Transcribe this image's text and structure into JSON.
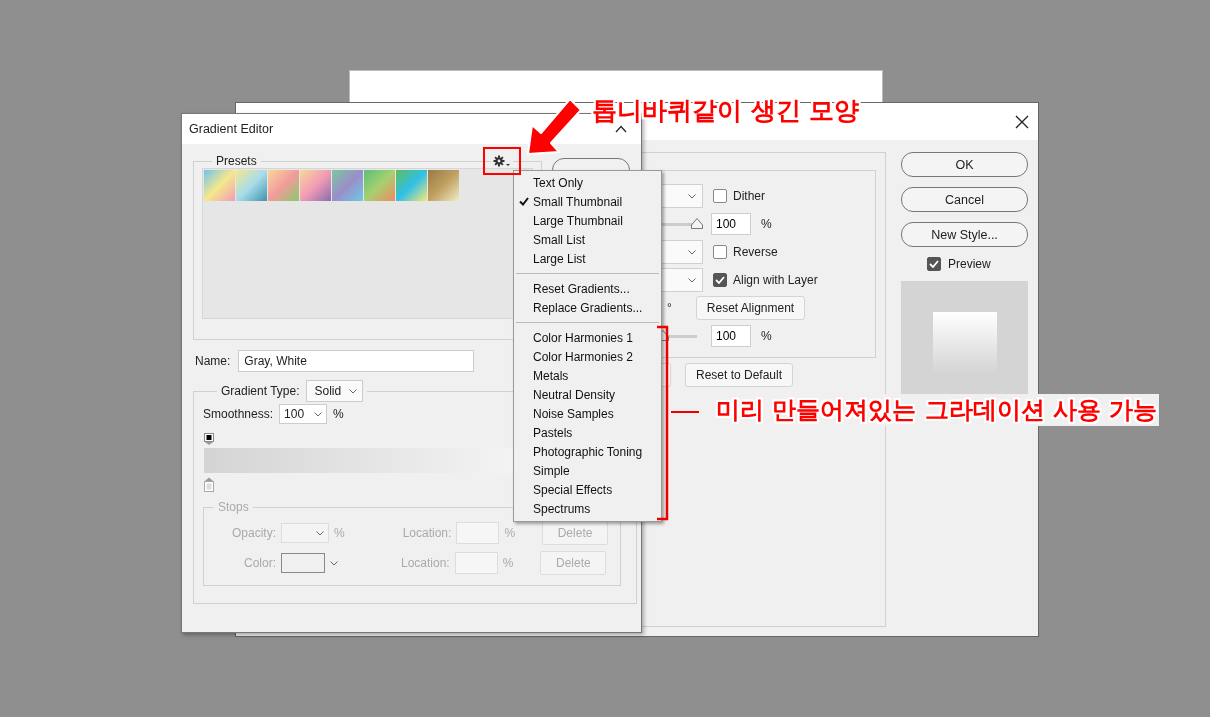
{
  "layer_style_dialog": {
    "rows": [
      {
        "kind": "select-checkbox",
        "label": "Dither",
        "checked": false
      },
      {
        "kind": "slider-input",
        "value": "100",
        "unit": "%"
      },
      {
        "kind": "select-checkbox",
        "label": "Reverse",
        "checked": false
      },
      {
        "kind": "select-checkbox",
        "label": "Align with Layer",
        "checked": true
      },
      {
        "kind": "angle",
        "unit": "°",
        "button": "Reset Alignment"
      },
      {
        "kind": "slider-input",
        "value": "100",
        "unit": "%"
      }
    ],
    "default_button": "Reset to Default",
    "buttons": [
      "OK",
      "Cancel",
      "New Style..."
    ],
    "preview": {
      "label": "Preview",
      "checked": true
    }
  },
  "gradient_editor": {
    "title": "Gradient Editor",
    "presets_label": "Presets",
    "name_label": "Name:",
    "name_value": "Gray, White",
    "gradient_type_label": "Gradient Type:",
    "gradient_type": "Solid",
    "smoothness_label": "Smoothness:",
    "smoothness": "100",
    "smoothness_unit": "%",
    "stops": {
      "label": "Stops",
      "disabled": true,
      "rows": [
        {
          "kind": "opacity",
          "label": "Opacity:",
          "unit": "%",
          "location_label": "Location:",
          "location_unit": "%",
          "button": "Delete"
        },
        {
          "kind": "color",
          "label": "Color:",
          "location_label": "Location:",
          "location_unit": "%",
          "button": "Delete"
        }
      ]
    }
  },
  "preset_menu": {
    "sections": [
      {
        "items": [
          {
            "label": "Text Only",
            "checked": false
          },
          {
            "label": "Small Thumbnail",
            "checked": true
          },
          {
            "label": "Large Thumbnail",
            "checked": false
          },
          {
            "label": "Small List",
            "checked": false
          },
          {
            "label": "Large List",
            "checked": false
          }
        ]
      },
      {
        "items": [
          {
            "label": "Reset Gradients..."
          },
          {
            "label": "Replace Gradients..."
          }
        ]
      },
      {
        "items": [
          {
            "label": "Color Harmonies 1"
          },
          {
            "label": "Color Harmonies 2"
          },
          {
            "label": "Metals"
          },
          {
            "label": "Neutral Density"
          },
          {
            "label": "Noise Samples"
          },
          {
            "label": "Pastels"
          },
          {
            "label": "Photographic Toning"
          },
          {
            "label": "Simple"
          },
          {
            "label": "Special Effects"
          },
          {
            "label": "Spectrums"
          }
        ]
      }
    ]
  },
  "annotations": [
    {
      "kind": "callout",
      "text": "톱니바퀴같이 생긴 모양"
    },
    {
      "kind": "bracket",
      "text": "미리 만들어져있는 그라데이션 사용 가능"
    }
  ]
}
